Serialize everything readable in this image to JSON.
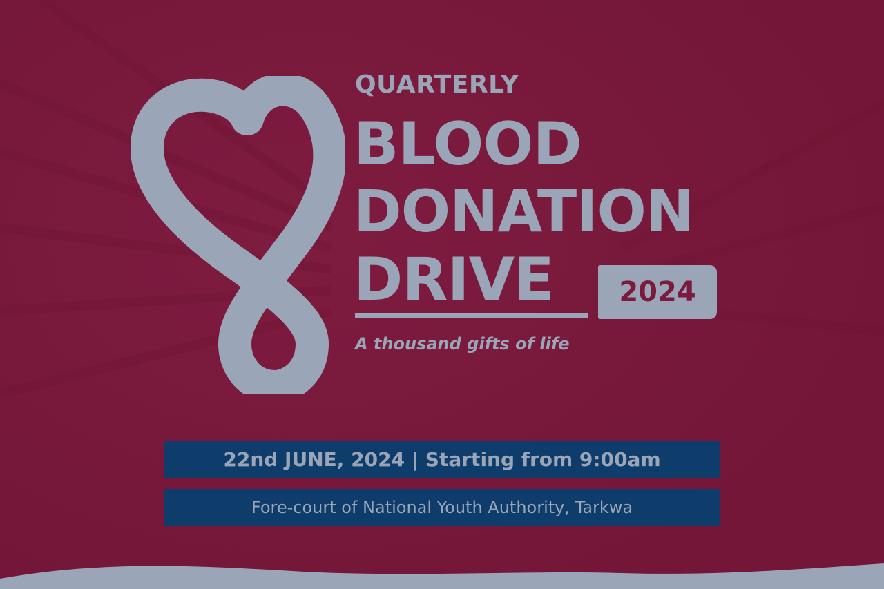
{
  "colors": {
    "background": "#7b1a3d",
    "foreground": "#9aa6b8",
    "info_bar": "#0f3d6b"
  },
  "logo": {
    "icon": "heart-infinity-icon"
  },
  "title": {
    "quarterly": "QUARTERLY",
    "line1": "BLOOD",
    "line2": "DONATION",
    "line3": "DRIVE",
    "year": "2024",
    "tagline": "A thousand gifts of life"
  },
  "details": {
    "date_time": "22nd JUNE, 2024 | Starting from 9:00am",
    "venue": "Fore-court of National Youth Authority, Tarkwa"
  }
}
